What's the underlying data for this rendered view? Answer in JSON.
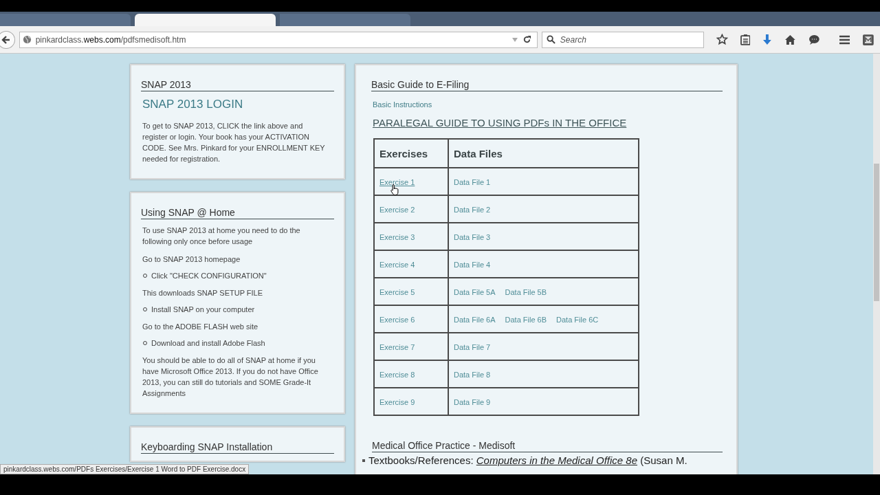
{
  "browser": {
    "url_host": "pinkardclass.",
    "url_domain": "webs.com",
    "url_path": "/pdfsmedisoft.htm",
    "search_placeholder": "Search",
    "status_link": "pinkardclass.webs.com/PDFs Exercises/Exercise 1 Word to PDF Exercise.docx"
  },
  "sidebar": [
    {
      "title": "SNAP 2013",
      "link": "SNAP 2013 LOGIN",
      "items": [
        {
          "kind": "text",
          "text": "To get to SNAP 2013, CLICK the link above and register or login. Your book has your ACTIVATION CODE.  See Mrs. Pinkard for your ENROLLMENT KEY needed for registration."
        }
      ]
    },
    {
      "title": "Using SNAP @ Home",
      "items": [
        {
          "kind": "text",
          "text": "To use SNAP 2013 at home you need to do the following only once before usage"
        },
        {
          "kind": "text",
          "text": "Go to SNAP 2013 homepage"
        },
        {
          "kind": "bullet",
          "text": "Click \"CHECK CONFIGURATION\""
        },
        {
          "kind": "text",
          "text": "This downloads SNAP SETUP FILE"
        },
        {
          "kind": "bullet",
          "text": "Install SNAP on your computer"
        },
        {
          "kind": "text",
          "text": "Go to the ADOBE FLASH web site"
        },
        {
          "kind": "bullet",
          "text": "Download and install Adobe Flash"
        },
        {
          "kind": "text",
          "text": "You should be able to do all of SNAP at home if you have Microsoft Office 2013.  If you do not have Office 2013, you can still do tutorials and SOME Grade-It Assignments"
        }
      ]
    },
    {
      "title": "Keyboarding SNAP Installation"
    }
  ],
  "tabs": [
    {
      "selected": false
    },
    {
      "selected": true
    },
    {
      "selected": false
    }
  ],
  "main": {
    "section_title": "Basic Guide to E-Filing",
    "link": "Basic Instructions",
    "heading": "PARALEGAL GUIDE TO USING PDFs IN THE OFFICE",
    "table": {
      "columns": [
        "Exercises",
        "Data Files"
      ],
      "rows": [
        {
          "exercise": "Exercise 1",
          "hovered": true,
          "files": [
            "Data File 1"
          ]
        },
        {
          "exercise": "Exercise 2",
          "hovered": false,
          "files": [
            "Data File 2"
          ]
        },
        {
          "exercise": "Exercise 3",
          "hovered": false,
          "files": [
            "Data File 3"
          ]
        },
        {
          "exercise": "Exercise 4",
          "hovered": false,
          "files": [
            "Data File 4"
          ]
        },
        {
          "exercise": "Exercise 5",
          "hovered": false,
          "files": [
            "Data File 5A",
            "Data File 5B"
          ]
        },
        {
          "exercise": "Exercise 6",
          "hovered": false,
          "files": [
            "Data File 6A",
            "Data File 6B",
            "Data File 6C"
          ]
        },
        {
          "exercise": "Exercise 7",
          "hovered": false,
          "files": [
            "Data File 7"
          ]
        },
        {
          "exercise": "Exercise 8",
          "hovered": false,
          "files": [
            "Data File 8"
          ]
        },
        {
          "exercise": "Exercise 9",
          "hovered": false,
          "files": [
            "Data File 9"
          ]
        }
      ]
    },
    "section2_title": "Medical Office Practice - Medisoft",
    "reference": {
      "label": "Textbooks/References: ",
      "book": "Computers in the Medical Office  8e",
      "after": " (Susan M."
    }
  }
}
